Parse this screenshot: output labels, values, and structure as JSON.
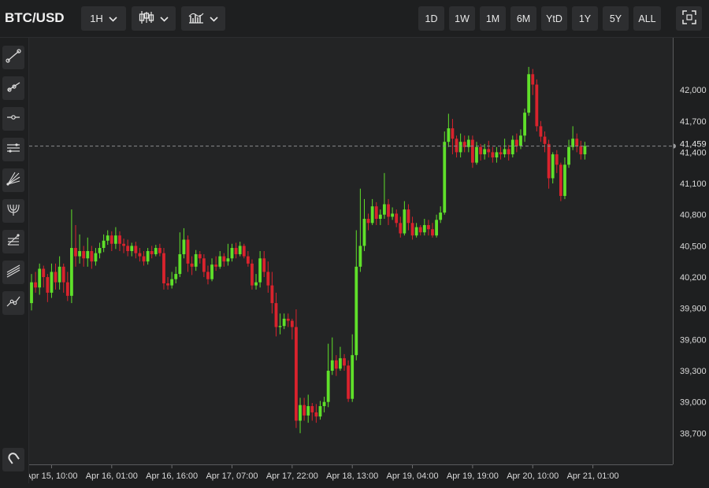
{
  "header": {
    "symbol": "BTC/USD",
    "interval": "1H",
    "chart_type_icon": "candlestick-icon",
    "indicators_icon": "indicators-icon",
    "ranges": [
      "1D",
      "1W",
      "1M",
      "6M",
      "YtD",
      "1Y",
      "5Y",
      "ALL"
    ],
    "fullscreen_icon": "fullscreen-icon"
  },
  "tools": [
    "trend-line-icon",
    "ray-line-icon",
    "horizontal-line-icon",
    "parallel-channel-icon",
    "gann-fan-icon",
    "pitchfork-icon",
    "fibonacci-icon",
    "regression-channel-icon",
    "polyline-icon"
  ],
  "bottom_tool": "magnet-icon",
  "colors": {
    "up": "#5fe02a",
    "down": "#d9232d",
    "background": "#232425",
    "grid": "#2f3032"
  },
  "chart_data": {
    "type": "candlestick",
    "ylim": [
      38400,
      42500
    ],
    "y_ticks": [
      38700,
      39000,
      39300,
      39600,
      39900,
      40200,
      40500,
      40800,
      41100,
      41400,
      41700,
      42000
    ],
    "x_ticks": [
      "Apr 15, 10:00",
      "Apr 16, 01:00",
      "Apr 16, 16:00",
      "Apr 17, 07:00",
      "Apr 17, 22:00",
      "Apr 18, 13:00",
      "Apr 19, 04:00",
      "Apr 19, 19:00",
      "Apr 20, 10:00",
      "Apr 21, 01:00"
    ],
    "x_tick_index": [
      5,
      20,
      35,
      50,
      65,
      80,
      95,
      110,
      125,
      140
    ],
    "grid": false,
    "last_price": 41459,
    "last_price_label": "41,459",
    "candles": [
      [
        39950,
        40150,
        39880,
        40230
      ],
      [
        40150,
        40100,
        40050,
        40250
      ],
      [
        40100,
        40280,
        40030,
        40330
      ],
      [
        40280,
        40200,
        40100,
        40310
      ],
      [
        40200,
        40050,
        39960,
        40230
      ],
      [
        40050,
        40250,
        40000,
        40330
      ],
      [
        40250,
        40150,
        40080,
        40330
      ],
      [
        40150,
        40300,
        40080,
        40400
      ],
      [
        40300,
        40150,
        40050,
        40330
      ],
      [
        40150,
        40020,
        39970,
        40250
      ],
      [
        40020,
        40480,
        39950,
        40850
      ],
      [
        40480,
        40400,
        40300,
        40700
      ],
      [
        40400,
        40450,
        40330,
        40610
      ],
      [
        40450,
        40380,
        40300,
        40500
      ],
      [
        40380,
        40450,
        40300,
        40580
      ],
      [
        40450,
        40350,
        40280,
        40500
      ],
      [
        40350,
        40430,
        40310,
        40480
      ],
      [
        40430,
        40480,
        40380,
        40530
      ],
      [
        40480,
        40550,
        40440,
        40610
      ],
      [
        40550,
        40600,
        40510,
        40650
      ],
      [
        40600,
        40520,
        40450,
        40640
      ],
      [
        40520,
        40600,
        40470,
        40680
      ],
      [
        40600,
        40520,
        40450,
        40640
      ],
      [
        40520,
        40500,
        40430,
        40570
      ],
      [
        40500,
        40450,
        40400,
        40560
      ],
      [
        40450,
        40500,
        40400,
        40530
      ],
      [
        40500,
        40430,
        40380,
        40540
      ],
      [
        40430,
        40400,
        40350,
        40480
      ],
      [
        40400,
        40350,
        40310,
        40450
      ],
      [
        40350,
        40450,
        40320,
        40480
      ],
      [
        40450,
        40420,
        40380,
        40500
      ],
      [
        40420,
        40480,
        40400,
        40510
      ],
      [
        40480,
        40430,
        40400,
        40520
      ],
      [
        40430,
        40140,
        40080,
        40480
      ],
      [
        40140,
        40120,
        40080,
        40200
      ],
      [
        40120,
        40180,
        40090,
        40250
      ],
      [
        40180,
        40230,
        40140,
        40300
      ],
      [
        40230,
        40420,
        40200,
        40630
      ],
      [
        40420,
        40560,
        40380,
        40670
      ],
      [
        40560,
        40330,
        40250,
        40600
      ],
      [
        40330,
        40300,
        40220,
        40400
      ],
      [
        40300,
        40420,
        40260,
        40460
      ],
      [
        40420,
        40380,
        40330,
        40450
      ],
      [
        40380,
        40250,
        40200,
        40420
      ],
      [
        40250,
        40180,
        40130,
        40310
      ],
      [
        40180,
        40320,
        40160,
        40380
      ],
      [
        40320,
        40300,
        40260,
        40400
      ],
      [
        40300,
        40400,
        40280,
        40450
      ],
      [
        40400,
        40350,
        40300,
        40430
      ],
      [
        40350,
        40380,
        40310,
        40520
      ],
      [
        40380,
        40480,
        40350,
        40520
      ],
      [
        40480,
        40420,
        40380,
        40530
      ],
      [
        40420,
        40500,
        40400,
        40540
      ],
      [
        40500,
        40400,
        40380,
        40520
      ],
      [
        40400,
        40330,
        40300,
        40450
      ],
      [
        40330,
        40120,
        40080,
        40370
      ],
      [
        40120,
        40150,
        40080,
        40230
      ],
      [
        40150,
        40380,
        40100,
        40450
      ],
      [
        40380,
        40250,
        40200,
        40450
      ],
      [
        40250,
        40120,
        40050,
        40350
      ],
      [
        40120,
        39950,
        39850,
        40250
      ],
      [
        39950,
        39720,
        39630,
        40050
      ],
      [
        39720,
        39730,
        39650,
        39850
      ],
      [
        39730,
        39800,
        39700,
        39850
      ],
      [
        39800,
        39780,
        39720,
        39850
      ],
      [
        39780,
        39720,
        39600,
        39800
      ],
      [
        39720,
        38820,
        38750,
        39890
      ],
      [
        38820,
        38970,
        38700,
        39040
      ],
      [
        38970,
        38870,
        38820,
        39040
      ],
      [
        38870,
        38960,
        38800,
        39070
      ],
      [
        38960,
        38900,
        38820,
        38990
      ],
      [
        38900,
        38860,
        38800,
        38980
      ],
      [
        38860,
        38960,
        38830,
        39010
      ],
      [
        38960,
        39000,
        38900,
        39050
      ],
      [
        39000,
        39300,
        38950,
        39560
      ],
      [
        39300,
        39400,
        39260,
        39620
      ],
      [
        39400,
        39320,
        39250,
        39450
      ],
      [
        39320,
        39420,
        39300,
        39530
      ],
      [
        39420,
        39350,
        39300,
        39460
      ],
      [
        39350,
        39030,
        39000,
        39400
      ],
      [
        39030,
        39450,
        39000,
        39650
      ],
      [
        39450,
        40300,
        39400,
        40650
      ],
      [
        40300,
        40500,
        40250,
        41050
      ],
      [
        40500,
        40760,
        40450,
        40950
      ],
      [
        40760,
        40720,
        40650,
        40810
      ],
      [
        40720,
        40880,
        40700,
        40950
      ],
      [
        40880,
        40760,
        40700,
        40920
      ],
      [
        40760,
        40800,
        40700,
        40850
      ],
      [
        40800,
        40900,
        40760,
        41200
      ],
      [
        40900,
        40780,
        40700,
        40950
      ],
      [
        40780,
        40810,
        40750,
        40870
      ],
      [
        40810,
        40720,
        40680,
        40850
      ],
      [
        40720,
        40620,
        40580,
        40780
      ],
      [
        40620,
        40850,
        40600,
        40930
      ],
      [
        40850,
        40720,
        40650,
        40900
      ],
      [
        40720,
        40600,
        40560,
        40780
      ],
      [
        40600,
        40680,
        40580,
        40720
      ],
      [
        40680,
        40630,
        40600,
        40700
      ],
      [
        40630,
        40700,
        40600,
        40760
      ],
      [
        40700,
        40660,
        40600,
        40750
      ],
      [
        40660,
        40600,
        40580,
        40720
      ],
      [
        40600,
        40750,
        40580,
        40800
      ],
      [
        40750,
        40820,
        40720,
        40880
      ],
      [
        40820,
        41500,
        40800,
        41600
      ],
      [
        41500,
        41630,
        41450,
        41770
      ],
      [
        41630,
        41530,
        41380,
        41720
      ],
      [
        41530,
        41400,
        41350,
        41560
      ],
      [
        41400,
        41500,
        41350,
        41580
      ],
      [
        41500,
        41450,
        41400,
        41560
      ],
      [
        41450,
        41520,
        41400,
        41560
      ],
      [
        41520,
        41300,
        41250,
        41560
      ],
      [
        41300,
        41450,
        41280,
        41500
      ],
      [
        41450,
        41380,
        41320,
        41480
      ],
      [
        41380,
        41430,
        41330,
        41480
      ],
      [
        41430,
        41400,
        41350,
        41510
      ],
      [
        41400,
        41350,
        41300,
        41450
      ],
      [
        41350,
        41400,
        41300,
        41450
      ],
      [
        41400,
        41380,
        41330,
        41450
      ],
      [
        41380,
        41430,
        41350,
        41530
      ],
      [
        41430,
        41380,
        41320,
        41470
      ],
      [
        41380,
        41520,
        41350,
        41560
      ],
      [
        41520,
        41460,
        41400,
        41580
      ],
      [
        41460,
        41560,
        41430,
        41620
      ],
      [
        41560,
        41780,
        41500,
        41820
      ],
      [
        41780,
        42150,
        41750,
        42220
      ],
      [
        42150,
        42050,
        41950,
        42200
      ],
      [
        42050,
        41650,
        41600,
        42100
      ],
      [
        41650,
        41550,
        41500,
        41700
      ],
      [
        41550,
        41480,
        41400,
        41600
      ],
      [
        41480,
        41150,
        41050,
        41520
      ],
      [
        41150,
        41380,
        41100,
        41400
      ],
      [
        41380,
        41280,
        41200,
        41420
      ],
      [
        41280,
        40980,
        40930,
        41300
      ],
      [
        40980,
        41280,
        40950,
        41350
      ],
      [
        41280,
        41450,
        41250,
        41520
      ],
      [
        41450,
        41530,
        41420,
        41650
      ],
      [
        41530,
        41460,
        41400,
        41580
      ],
      [
        41460,
        41380,
        41330,
        41510
      ],
      [
        41380,
        41460,
        41330,
        41500
      ]
    ]
  }
}
